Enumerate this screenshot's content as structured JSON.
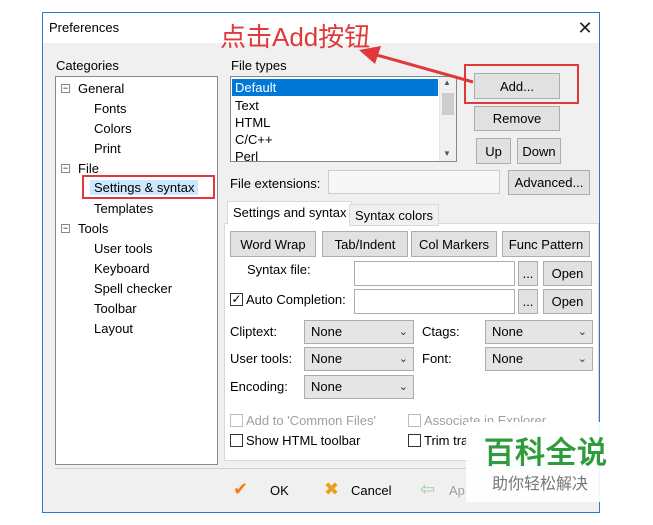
{
  "window": {
    "title": "Preferences",
    "close_label": "✕"
  },
  "categories": {
    "label": "Categories",
    "items": [
      {
        "label": "General",
        "toggle": "−"
      },
      {
        "label": "Fonts"
      },
      {
        "label": "Colors"
      },
      {
        "label": "Print"
      },
      {
        "label": "File",
        "toggle": "−"
      },
      {
        "label": "Settings & syntax"
      },
      {
        "label": "Templates"
      },
      {
        "label": "Tools",
        "toggle": "−"
      },
      {
        "label": "User tools"
      },
      {
        "label": "Keyboard"
      },
      {
        "label": "Spell checker"
      },
      {
        "label": "Toolbar"
      },
      {
        "label": "Layout"
      }
    ]
  },
  "file_types": {
    "label": "File types",
    "items": [
      "Default",
      "Text",
      "HTML",
      "C/C++",
      "Perl"
    ],
    "selected": "Default",
    "buttons": {
      "add": "Add...",
      "remove": "Remove",
      "up": "Up",
      "down": "Down"
    }
  },
  "file_extensions": {
    "label": "File extensions:",
    "value": "",
    "advanced_button": "Advanced..."
  },
  "tabs": {
    "settings": "Settings and syntax",
    "colors": "Syntax colors"
  },
  "toolbar_buttons": {
    "word_wrap": "Word Wrap",
    "tab_indent": "Tab/Indent",
    "col_markers": "Col Markers",
    "func_pattern": "Func Pattern"
  },
  "syntax_file": {
    "label": "Syntax file:",
    "value": "",
    "browse": "...",
    "open": "Open"
  },
  "auto_completion": {
    "label": "Auto Completion:",
    "checked": true,
    "value": "",
    "browse": "...",
    "open": "Open"
  },
  "dropdowns": {
    "cliptext": {
      "label": "Cliptext:",
      "value": "None"
    },
    "user_tools": {
      "label": "User tools:",
      "value": "None"
    },
    "encoding": {
      "label": "Encoding:",
      "value": "None"
    },
    "ctags": {
      "label": "Ctags:",
      "value": "None"
    },
    "font": {
      "label": "Font:",
      "value": "None"
    }
  },
  "checkboxes": {
    "add_common": {
      "label": "Add to 'Common Files'",
      "checked": false,
      "enabled": false
    },
    "associate": {
      "label": "Associate in Explorer",
      "checked": false,
      "enabled": false
    },
    "show_html_toolbar": {
      "label": "Show HTML toolbar",
      "checked": false,
      "enabled": true
    },
    "trim": {
      "label": "Trim tra",
      "checked": false,
      "enabled": true
    }
  },
  "footer": {
    "ok": "OK",
    "cancel": "Cancel",
    "apply": "Ap"
  },
  "annotation": {
    "text": "点击Add按钮",
    "color": "#e0393b"
  },
  "watermark": {
    "title": "百科全说",
    "subtitle": "助你轻松解决"
  },
  "colors": {
    "selection": "#0078d7",
    "annotation_red": "#e0393b",
    "watermark_green": "#2e9b3c"
  }
}
